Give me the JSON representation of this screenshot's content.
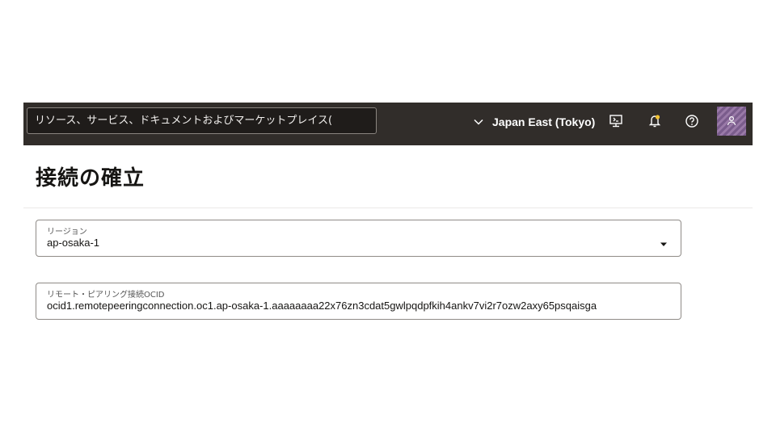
{
  "header": {
    "search_placeholder": "リソース、サービス、ドキュメントおよびマーケットプレイス(",
    "region_label": "Japan East (Tokyo)",
    "icons": [
      "chevron-down-icon",
      "cloud-shell-icon",
      "bell-icon",
      "help-icon",
      "profile-icon"
    ],
    "colors": {
      "background": "#312d2a",
      "bell_dot": "#f1c232"
    }
  },
  "page": {
    "title": "接続の確立"
  },
  "form": {
    "region_field": {
      "label": "リージョン",
      "value": "ap-osaka-1"
    },
    "remote_peering_field": {
      "label": "リモート・ピアリング接続OCID",
      "value": "ocid1.remotepeeringconnection.oc1.ap-osaka-1.aaaaaaaa22x76zn3cdat5gwlpqdpfkih4ankv7vi2r7ozw2axy65psqaisga"
    }
  }
}
